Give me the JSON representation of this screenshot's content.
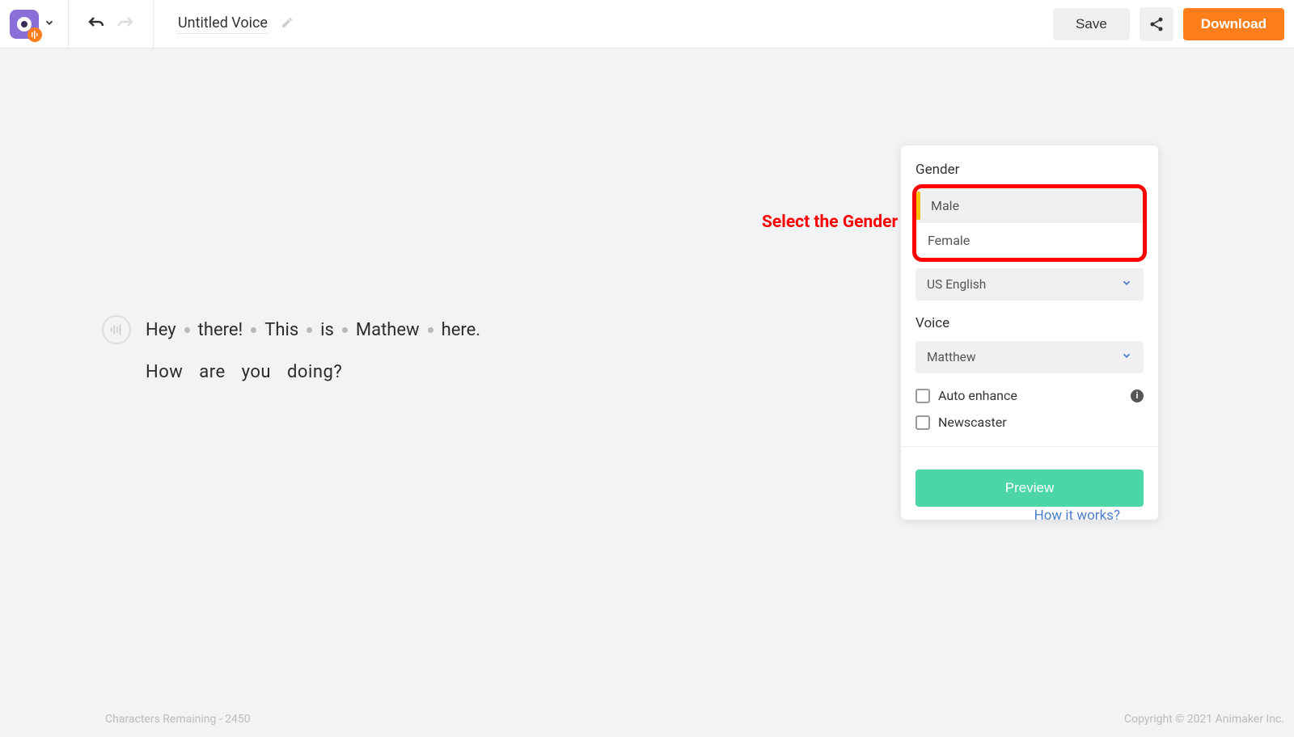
{
  "header": {
    "title": "Untitled Voice",
    "save_label": "Save",
    "download_label": "Download"
  },
  "text": {
    "words": [
      "Hey",
      "there!",
      "This",
      "is",
      "Mathew",
      "here."
    ],
    "line2_w1": "How",
    "line2_w2": "are",
    "line2_w3": "you",
    "line2_w4": "doing?"
  },
  "annotation": "Select the Gender",
  "panel": {
    "gender_label": "Gender",
    "gender_options": {
      "male": "Male",
      "female": "Female"
    },
    "language_selected": "US English",
    "voice_label": "Voice",
    "voice_selected": "Matthew",
    "auto_enhance": "Auto enhance",
    "newscaster": "Newscaster",
    "preview_label": "Preview"
  },
  "how_works": "How it works?",
  "footer": {
    "chars_remaining": "Characters Remaining - 2450",
    "copyright": "Copyright © 2021 Animaker Inc."
  }
}
